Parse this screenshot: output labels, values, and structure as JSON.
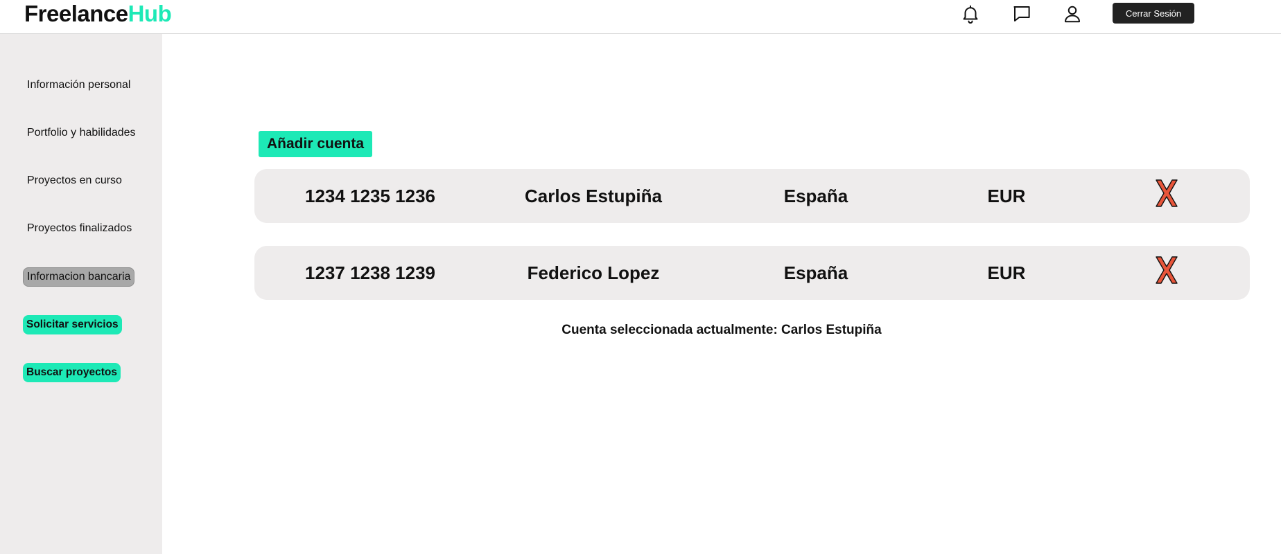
{
  "header": {
    "logo_part1": "Freelance",
    "logo_part2": "Hub",
    "logout_label": "Cerrar Sesión",
    "icons": [
      "bell-icon",
      "chat-icon",
      "user-icon"
    ]
  },
  "sidebar": {
    "items": [
      {
        "label": "Información personal"
      },
      {
        "label": "Portfolio y habilidades"
      },
      {
        "label": "Proyectos en curso"
      },
      {
        "label": "Proyectos finalizados"
      },
      {
        "label": "Informacion bancaria",
        "active": true
      },
      {
        "label": "Solicitar servicios",
        "highlight": true
      },
      {
        "label": "Buscar proyectos",
        "highlight": true
      }
    ]
  },
  "main": {
    "add_account_label": "Añadir cuenta",
    "accounts": [
      {
        "number": "1234 1235 1236",
        "holder": "Carlos Estupiña",
        "country": "España",
        "currency": "EUR",
        "delete_icon": "delete-x-icon"
      },
      {
        "number": "1237 1238 1239",
        "holder": "Federico Lopez",
        "country": "España",
        "currency": "EUR",
        "delete_icon": "delete-x-icon"
      }
    ],
    "selected_account_text": "Cuenta seleccionada actualmente: Carlos Estupiña"
  },
  "colors": {
    "accent": "#1de9b6",
    "sidebar_bg": "#eeecec",
    "active_item_bg": "#a8a8a8",
    "delete_icon": "#e8553a",
    "logout_bg": "#222222"
  }
}
